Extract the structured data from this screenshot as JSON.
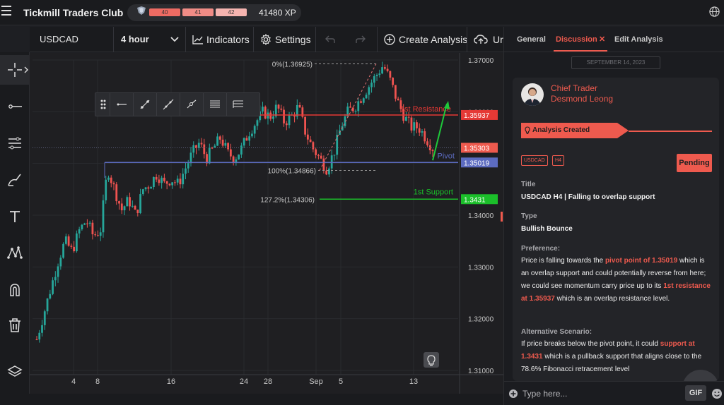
{
  "app": {
    "title": "Tickmill Traders Club"
  },
  "xp": {
    "levels": [
      "40",
      "41",
      "42"
    ],
    "total": "41480 XP"
  },
  "toolbar": {
    "symbol": "USDCAD",
    "timeframe": "4 hour",
    "indicators": "Indicators",
    "settings": "Settings",
    "create_analysis": "Create Analysis",
    "upload_fragment": "Ur"
  },
  "chart": {
    "price_ticks": [
      "1.37000",
      "1.36000",
      "1.35000",
      "1.34000",
      "1.33000",
      "1.32000",
      "1.31000"
    ],
    "date_ticks": [
      "4",
      "8",
      "16",
      "24",
      "28",
      "Sep",
      "5",
      "13"
    ],
    "annotations": {
      "fib0": "0%(1.36925)",
      "fib100": "100%(1.34866)",
      "fib127": "127.2%(1.34306)",
      "resistance_label": "1st Resistance",
      "support_label": "1st Support",
      "pivot_label": "Pivot"
    },
    "price_tags": {
      "resistance": "1.35937",
      "current": "1.35303",
      "pivot": "1.35019",
      "support": "1.3431"
    },
    "colors": {
      "up": "#26a69a",
      "down": "#ef5350",
      "resistance": "#e53935",
      "support": "#1bbf2a",
      "pivot": "#5c6bc0",
      "arrow": "#1ec93a"
    }
  },
  "chart_data": {
    "type": "candlestick",
    "title": "USDCAD",
    "timeframe": "4 hour",
    "x_ticks": [
      "4",
      "8",
      "16",
      "24",
      "28",
      "Sep",
      "5",
      "13"
    ],
    "y_ticks": [
      1.37,
      1.36,
      1.35,
      1.34,
      1.33,
      1.32,
      1.31
    ],
    "ylim": [
      1.31,
      1.37
    ],
    "levels": [
      {
        "name": "1st Resistance",
        "value": 1.35937
      },
      {
        "name": "Pivot",
        "value": 1.35019
      },
      {
        "name": "1st Support",
        "value": 1.3431
      }
    ],
    "fibonacci": [
      {
        "label": "0%",
        "value": 1.36925
      },
      {
        "label": "100%",
        "value": 1.34866
      },
      {
        "label": "127.2%",
        "value": 1.34306
      }
    ],
    "current_price": 1.35303,
    "close_path": [
      [
        0,
        1.316
      ],
      [
        2,
        1.321
      ],
      [
        4,
        1.326
      ],
      [
        6,
        1.331
      ],
      [
        8,
        1.335
      ],
      [
        10,
        1.333
      ],
      [
        12,
        1.337
      ],
      [
        14,
        1.339
      ],
      [
        16,
        1.336
      ],
      [
        18,
        1.337
      ],
      [
        20,
        1.349
      ],
      [
        22,
        1.345
      ],
      [
        24,
        1.341
      ],
      [
        26,
        1.343
      ],
      [
        28,
        1.34
      ],
      [
        30,
        1.345
      ],
      [
        32,
        1.346
      ],
      [
        34,
        1.348
      ],
      [
        36,
        1.346
      ],
      [
        38,
        1.347
      ],
      [
        40,
        1.346
      ],
      [
        42,
        1.349
      ],
      [
        44,
        1.352
      ],
      [
        46,
        1.354
      ],
      [
        48,
        1.351
      ],
      [
        50,
        1.353
      ],
      [
        52,
        1.355
      ],
      [
        54,
        1.352
      ],
      [
        56,
        1.351
      ],
      [
        58,
        1.353
      ],
      [
        60,
        1.356
      ],
      [
        62,
        1.358
      ],
      [
        64,
        1.36
      ],
      [
        66,
        1.359
      ],
      [
        68,
        1.361
      ],
      [
        70,
        1.358
      ],
      [
        72,
        1.359
      ],
      [
        74,
        1.361
      ],
      [
        76,
        1.356
      ],
      [
        78,
        1.353
      ],
      [
        80,
        1.351
      ],
      [
        82,
        1.349
      ],
      [
        84,
        1.352
      ],
      [
        86,
        1.357
      ],
      [
        88,
        1.36
      ],
      [
        90,
        1.361
      ],
      [
        92,
        1.363
      ],
      [
        94,
        1.365
      ],
      [
        96,
        1.367
      ],
      [
        98,
        1.369
      ],
      [
        100,
        1.366
      ],
      [
        102,
        1.362
      ],
      [
        104,
        1.359
      ],
      [
        106,
        1.357
      ],
      [
        108,
        1.357
      ],
      [
        110,
        1.355
      ],
      [
        112,
        1.353
      ]
    ]
  },
  "draw_tools": [
    "drag-handle-icon",
    "horizontal-ray-icon",
    "trend-line-icon",
    "extended-line-icon",
    "info-line-icon",
    "parallel-channel-icon",
    "fib-retracement-icon"
  ],
  "left_tools": [
    "crosshair-icon",
    "horizontal-line-icon",
    "channel-icon",
    "brush-icon",
    "text-icon",
    "pattern-icon",
    "magnet-icon",
    "trash-icon",
    "layers-icon"
  ],
  "panel": {
    "tabs": [
      "General",
      "Discussion",
      "Edit Analysis"
    ],
    "active_tab": "Discussion",
    "date": "SEPTEMBER 14, 2023",
    "author": {
      "role": "Chief Trader",
      "name": "Desmond Leong"
    },
    "banner": "Analysis Created",
    "tags": [
      "USDCAD",
      "H4"
    ],
    "status": "Pending",
    "title_label": "Title",
    "title_value": "USDCAD H4 | Falling to overlap support",
    "type_label": "Type",
    "type_value": "Bullish Bounce",
    "preference_label": "Preference:",
    "preference": {
      "t1": "Price is falling towards the ",
      "h1": "pivot point of 1.35019",
      "t2": " which is an overlap support and could potentially reverse from here; we could see momentum carry price up to its ",
      "h2": "1st resistance at 1.35937",
      "t3": " which is an overlap resistance level."
    },
    "alt_label": "Alternative Scenario:",
    "alternative": {
      "t1": "If price breaks below the pivot point, it could ",
      "h1": "support at 1.3431",
      "t2": " which is a pullback support that aligns close to the 78.6% Fibonacci retracement level"
    },
    "input_placeholder": "Type here...",
    "gif_label": "GIF"
  }
}
